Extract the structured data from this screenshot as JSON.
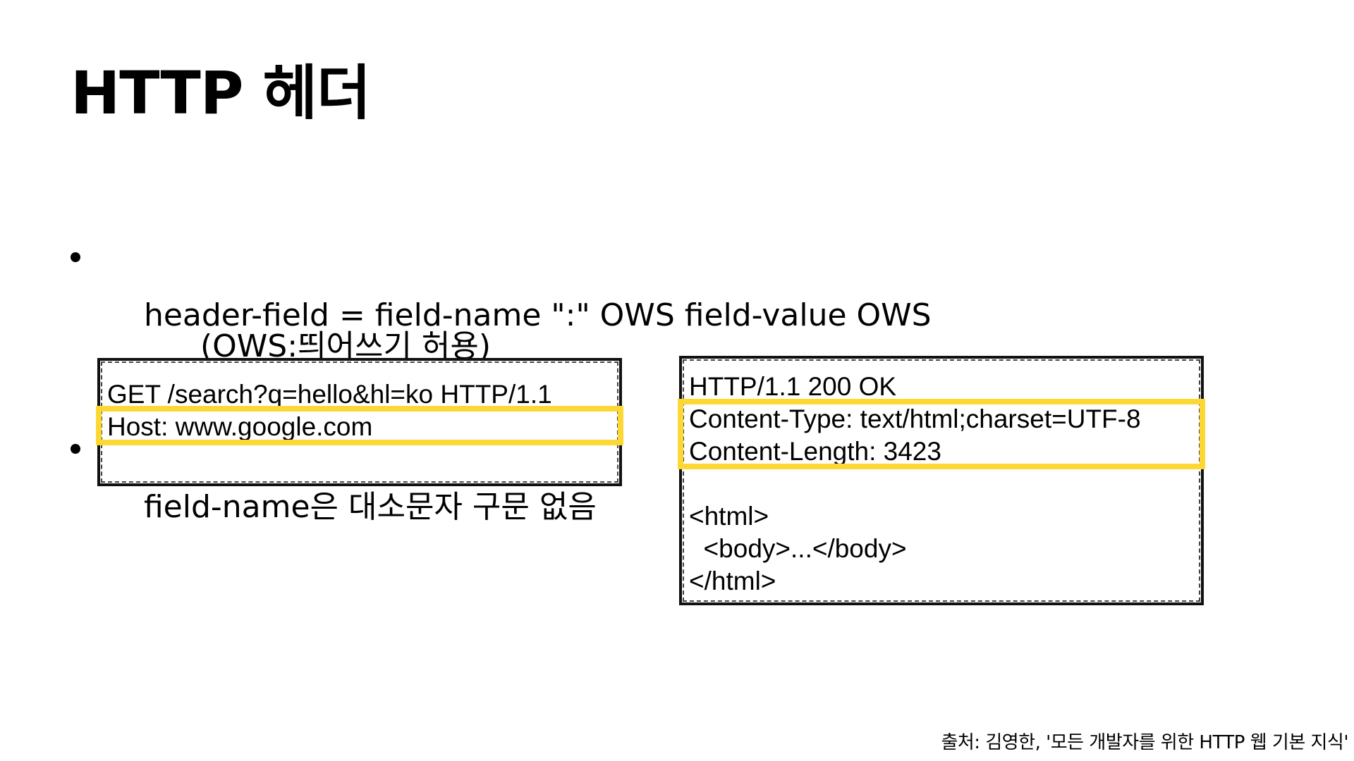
{
  "slide": {
    "title": "HTTP 헤더"
  },
  "bullets": [
    {
      "text": "header-field = field-name \":\" OWS field-value OWS",
      "note": "(OWS:띄어쓰기 허용)"
    },
    {
      "text": "field-name은 대소문자 구문 없음",
      "note": ""
    }
  ],
  "request_box": {
    "lines": [
      "GET /search?q=hello&hl=ko HTTP/1.1",
      "Host: www.google.com",
      ""
    ]
  },
  "response_box": {
    "lines": [
      "HTTP/1.1 200 OK",
      "Content-Type: text/html;charset=UTF-8",
      "Content-Length: 3423",
      "",
      "<html>",
      "  <body>...</body>",
      "</html>"
    ]
  },
  "source": {
    "caption": "출처: 김영한, '모든 개발자를 위한 HTTP 웹 기본 지식'"
  },
  "colors": {
    "highlight": "#fdd835",
    "text": "#000000",
    "background": "#ffffff"
  }
}
